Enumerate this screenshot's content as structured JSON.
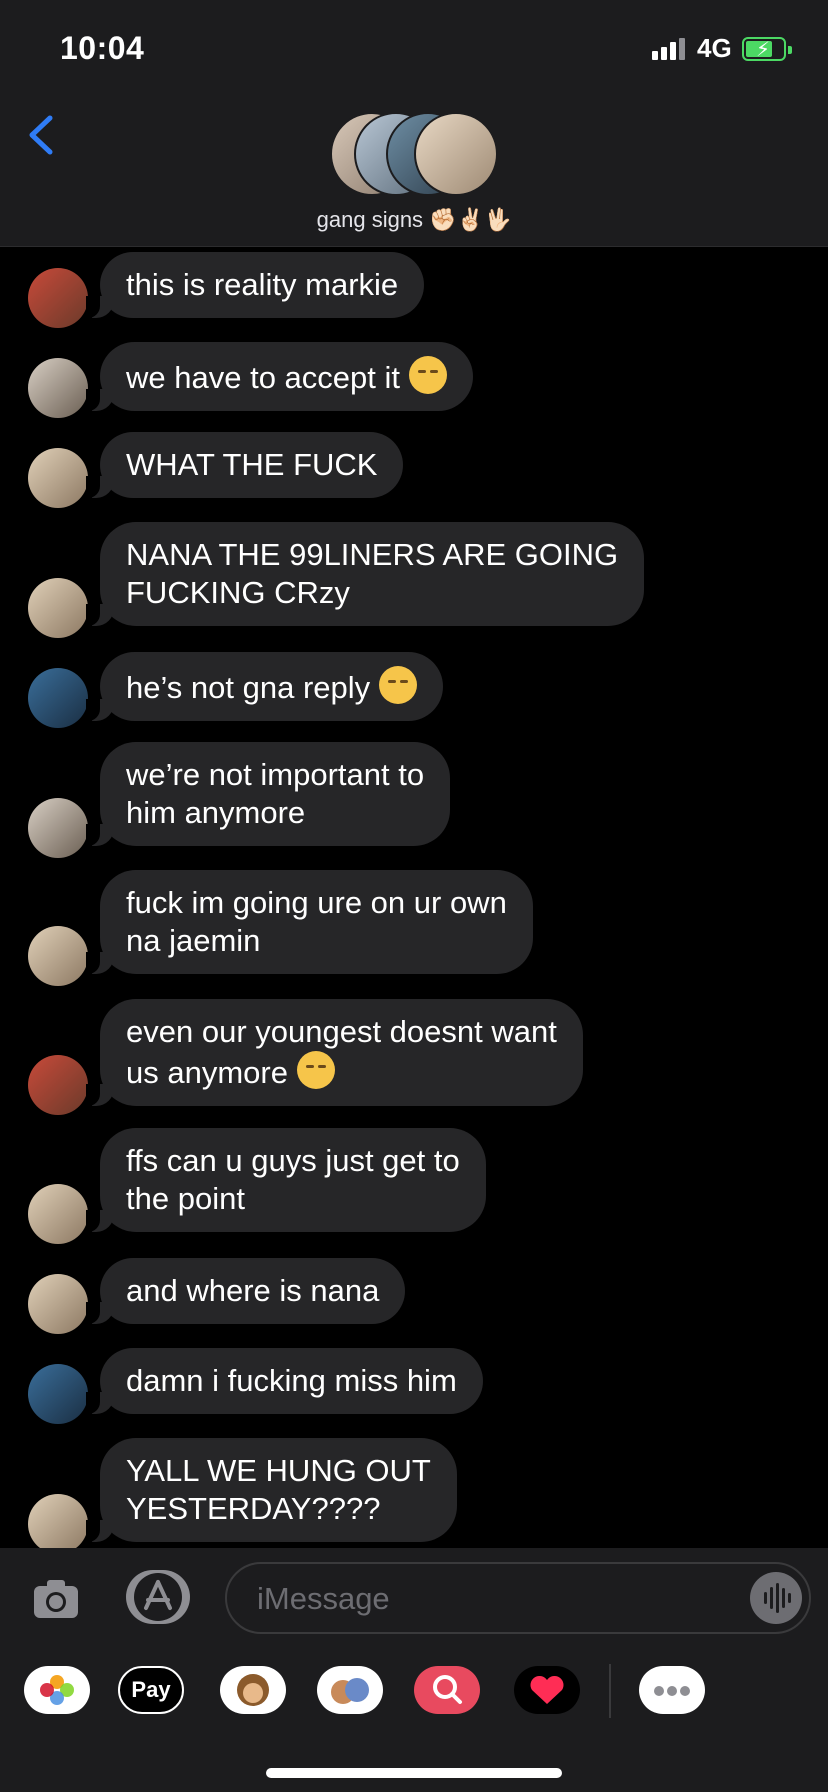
{
  "status_bar": {
    "time": "10:04",
    "network": "4G"
  },
  "header": {
    "group_name": "gang signs ✊🏻✌🏻🖖🏻"
  },
  "messages": [
    {
      "text": "this is reality markie",
      "emoji": false
    },
    {
      "text": "we have to accept it",
      "emoji": true
    },
    {
      "text": "WHAT THE FUCK",
      "emoji": false
    },
    {
      "line1": "NANA THE 99LINERS ARE GOING",
      "line2": "FUCKING CRzy"
    },
    {
      "text": "he’s not gna reply",
      "emoji": true
    },
    {
      "line1": "we’re not important to",
      "line2": "him anymore"
    },
    {
      "line1": "fuck im going ure on ur own",
      "line2": "na jaemin"
    },
    {
      "line1": "even our youngest doesnt want",
      "line2": "us anymore",
      "emoji": true
    },
    {
      "line1": "ffs can u guys just get to",
      "line2": "the point"
    },
    {
      "text": "and where is nana",
      "emoji": false
    },
    {
      "text": "damn i fucking miss him",
      "emoji": false
    },
    {
      "line1": "YALL WE HUNG OUT",
      "line2": "YESTERDAY????"
    }
  ],
  "composer": {
    "placeholder": "iMessage",
    "apple_pay": " Pay"
  },
  "icons": [
    "back-chevron-icon",
    "camera-icon",
    "app-store-icon",
    "audio-icon",
    "photos-icon",
    "monkey-memoji-icon",
    "memoji-icon",
    "search-images-icon",
    "digital-touch-icon",
    "more-icon"
  ],
  "colors": {
    "accent": "#2f7cf6",
    "bubble": "#262628",
    "header": "#1c1c1e",
    "battery": "#4cd964"
  }
}
